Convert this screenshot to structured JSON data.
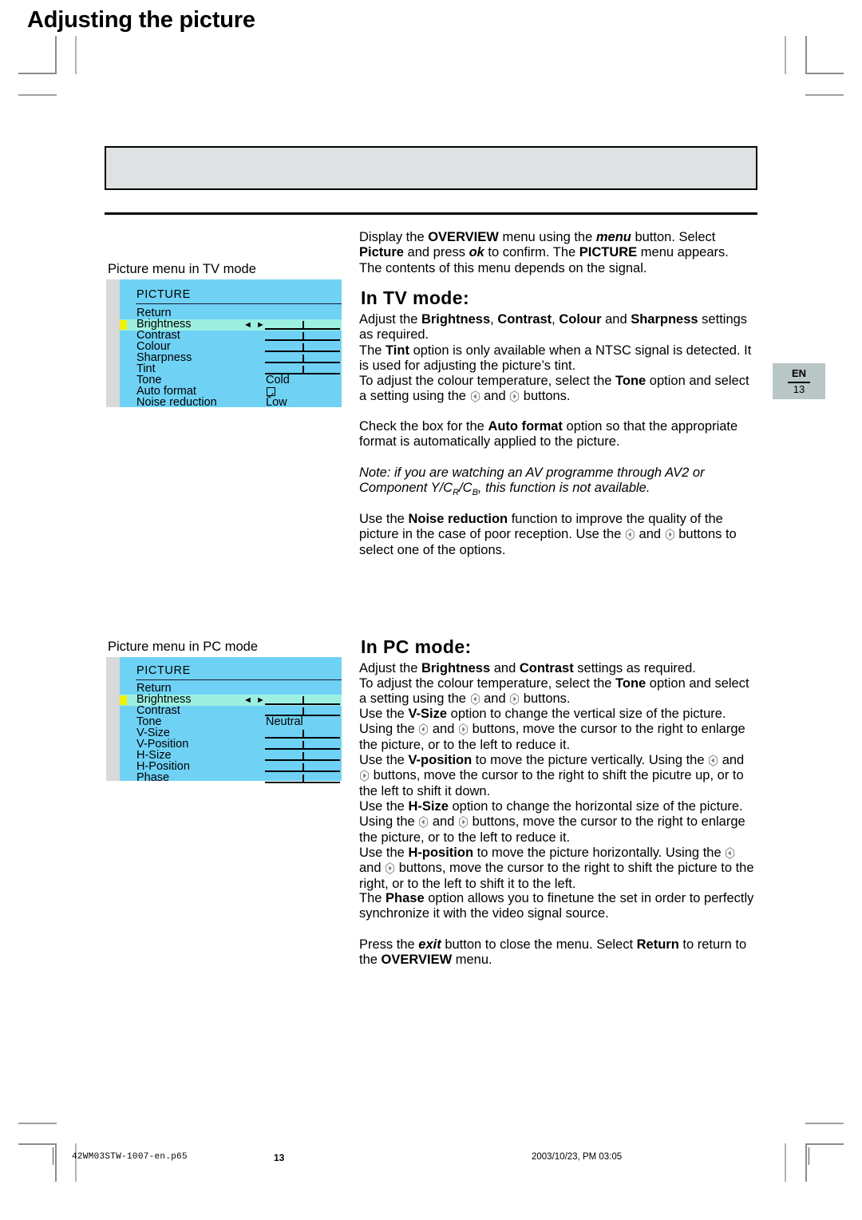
{
  "page": {
    "title": "Adjusting the picture",
    "lang_tab": {
      "language": "EN",
      "number": "13"
    },
    "footer": {
      "file": "42WM03STW-1007-en.p65",
      "page_number": "13",
      "timestamp": "2003/10/23, PM 03:05"
    }
  },
  "colors": {
    "banner_fill": "#dfe2e2",
    "osd_background": "#6fd2f5",
    "osd_selected_row": "#9df0e0",
    "osd_cursor": "#f2f200",
    "osd_gutter": "#d9d9d9",
    "page_tab": "#b9c6c6"
  },
  "intro": {
    "line1_a": "Display the ",
    "line1_overview": "OVERVIEW",
    "line1_b": " menu using the ",
    "line1_menu": "menu",
    "line1_c": " button.  Select ",
    "line1_picture": "Picture",
    "line2_a": "and press ",
    "line2_ok": "ok",
    "line2_b": " to confirm.  The ",
    "line2_picture": "PICTURE",
    "line2_c": " menu appears.",
    "line3": "The contents of this menu depends on the signal."
  },
  "tv_section": {
    "caption": "Picture menu in TV mode",
    "heading": "In TV mode:",
    "para1_a": "Adjust the ",
    "para1_brightness": "Brightness",
    "para1_b": ", ",
    "para1_contrast": "Contrast",
    "para1_c": ", ",
    "para1_colour": "Colour",
    "para1_d": " and ",
    "para1_sharpness": "Sharpness",
    "para1_e": " settings as required.",
    "para2_a": "The ",
    "para2_tint": "Tint",
    "para2_b": " option is only available when a NTSC signal is detected.  It is used for adjusting the picture’s tint.",
    "para3_a": "To adjust the colour temperature, select the ",
    "para3_tone": "Tone",
    "para3_b": " option and select a setting using the ",
    "para3_c": " and ",
    "para3_d": " buttons.",
    "para4_a": "Check the box for the ",
    "para4_autoformat": "Auto format",
    "para4_b": " option so that the appropriate format is automatically applied to the picture.",
    "note_a": "Note: if you are watching an AV programme through AV2 or Component Y/C",
    "note_sub1": "R",
    "note_mid": "/C",
    "note_sub2": "B",
    "note_b": ", this function is not available.",
    "para5_a": "Use the ",
    "para5_noise": "Noise reduction",
    "para5_b": " function to improve the quality of the picture in the case of poor reception. Use the ",
    "para5_c": " and ",
    "para5_d": " buttons to select one of the options."
  },
  "pc_section": {
    "caption": "Picture menu in PC mode",
    "heading": "In PC mode:",
    "para1_a": "Adjust the ",
    "para1_brightness": "Brightness",
    "para1_b": " and ",
    "para1_contrast": "Contrast",
    "para1_c": " settings as required.",
    "para2_a": "To adjust the colour temperature, select the ",
    "para2_tone": "Tone",
    "para2_b": " option and select a setting using the ",
    "para2_c": " and ",
    "para2_d": " buttons.",
    "para3_a": "Use the ",
    "para3_vsize": "V-Size",
    "para3_b": " option to change the vertical size of the picture.  Using the ",
    "para3_c": " and ",
    "para3_d": " buttons, move the cursor to the right to enlarge the picture, or to the left to reduce it.",
    "para4_a": "Use the ",
    "para4_vposition": "V-position",
    "para4_b": " to move the picture vertically.  Using the ",
    "para4_c": " and ",
    "para4_d": " buttons, move the cursor to the right to shift the picutre up, or to the left to shift it down.",
    "para5_a": "Use the ",
    "para5_hsize": "H-Size",
    "para5_b": " option to change the horizontal size of the picture. Using the ",
    "para5_c": " and ",
    "para5_d": " buttons, move the cursor to the right to enlarge the picture, or to the left to reduce it.",
    "para6_a": "Use the ",
    "para6_hposition": "H-position",
    "para6_b": " to move the picture horizontally.  Using the ",
    "para6_c": " and ",
    "para6_d": " buttons, move the cursor to the right to shift the picture to the right, or to the left to shift it to the left.",
    "para7_a": "The ",
    "para7_phase": "Phase",
    "para7_b": " option allows you to finetune the set in order to perfectly synchronize it with the video signal source.",
    "para8_a": "Press the ",
    "para8_exit": "exit",
    "para8_b": " button to close the menu.  Select ",
    "para8_return": "Return",
    "para8_c": " to return to the ",
    "para8_overview": "OVERVIEW",
    "para8_d": " menu."
  },
  "osd_tv": {
    "title": "PICTURE",
    "rows": [
      {
        "label": "Return",
        "type": "plain",
        "value": ""
      },
      {
        "label": "Brightness",
        "type": "slider",
        "value": "",
        "selected": true,
        "arrows": "◄ ►"
      },
      {
        "label": "Contrast",
        "type": "slider",
        "value": ""
      },
      {
        "label": "Colour",
        "type": "slider",
        "value": ""
      },
      {
        "label": "Sharpness",
        "type": "slider",
        "value": ""
      },
      {
        "label": "Tint",
        "type": "slider",
        "value": ""
      },
      {
        "label": "Tone",
        "type": "text",
        "value": "Cold"
      },
      {
        "label": "Auto format",
        "type": "checkbox",
        "value": "checked"
      },
      {
        "label": "Noise reduction",
        "type": "text",
        "value": "Low"
      }
    ]
  },
  "osd_pc": {
    "title": "PICTURE",
    "rows": [
      {
        "label": "Return",
        "type": "plain",
        "value": ""
      },
      {
        "label": "Brightness",
        "type": "slider",
        "value": "",
        "selected": true,
        "arrows": "◄ ►"
      },
      {
        "label": "Contrast",
        "type": "slider",
        "value": ""
      },
      {
        "label": "Tone",
        "type": "text",
        "value": "Neutral"
      },
      {
        "label": "V-Size",
        "type": "slider",
        "value": ""
      },
      {
        "label": "V-Position",
        "type": "slider",
        "value": ""
      },
      {
        "label": "H-Size",
        "type": "slider",
        "value": ""
      },
      {
        "label": "H-Position",
        "type": "slider",
        "value": ""
      },
      {
        "label": "Phase",
        "type": "slider",
        "value": ""
      }
    ]
  }
}
